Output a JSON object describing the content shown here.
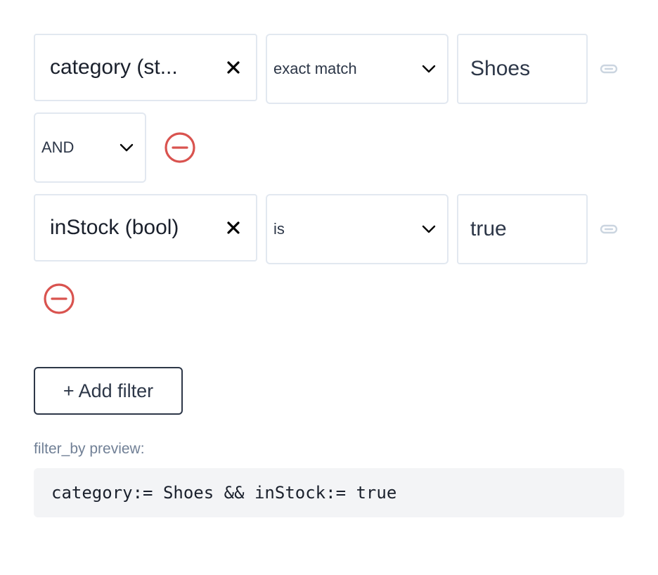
{
  "filters": [
    {
      "field_label": "category (st...",
      "operator": "exact match",
      "value": "Shoes"
    },
    {
      "field_label": "inStock (bool)",
      "operator": "is",
      "value": "true"
    }
  ],
  "join_operator": "AND",
  "add_filter_label": "+ Add filter",
  "preview": {
    "label": "filter_by preview:",
    "code": "category:= Shoes && inStock:= true"
  },
  "icons": {
    "clear": "close-icon",
    "dropdown": "chevron-down-icon",
    "link": "link-icon",
    "remove": "remove-circle-icon"
  },
  "colors": {
    "remove": "#d9534f",
    "border": "#e2e8f0",
    "link_icon": "#cbd5e0",
    "preview_bg": "#f3f4f6",
    "text": "#2d3748",
    "muted": "#718096"
  }
}
